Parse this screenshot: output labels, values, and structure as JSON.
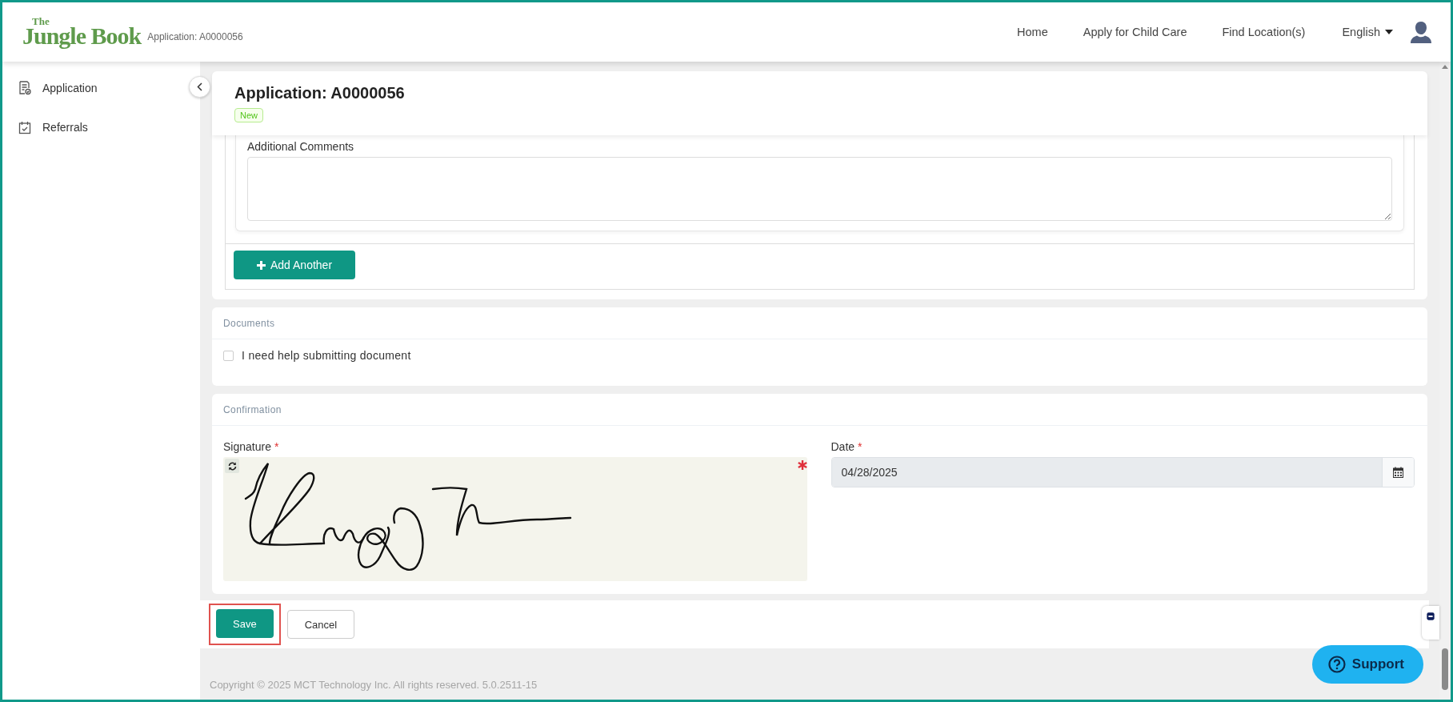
{
  "header": {
    "logo_top": "The",
    "logo_main": "Jungle Book",
    "subtitle": "Application: A0000056",
    "nav": [
      {
        "label": "Home"
      },
      {
        "label": "Apply for Child Care"
      },
      {
        "label": "Find Location(s)"
      }
    ],
    "language": "English"
  },
  "sidebar": {
    "items": [
      {
        "label": "Application"
      },
      {
        "label": "Referrals"
      }
    ]
  },
  "page_title": "Application: A0000056",
  "status_badge": "New",
  "comments": {
    "label": "Additional Comments"
  },
  "add_button": "Add Another",
  "documents": {
    "title": "Documents",
    "checkbox": {
      "label": "I need help submitting document",
      "checked": false
    }
  },
  "confirmation": {
    "title": "Confirmation",
    "signature": {
      "label": "Signature",
      "required_mark": "*"
    },
    "date": {
      "label": "Date",
      "required_mark": "*",
      "value": "04/28/2025"
    }
  },
  "actions": [
    {
      "label": "Save",
      "kind": "primary",
      "highlighted": true
    },
    {
      "label": "Cancel",
      "kind": "secondary",
      "highlighted": false
    }
  ],
  "footer": {
    "copyright": "Copyright © 2025 MCT Technology Inc. All rights reserved. 5.0.2511-15",
    "support": "Support"
  }
}
